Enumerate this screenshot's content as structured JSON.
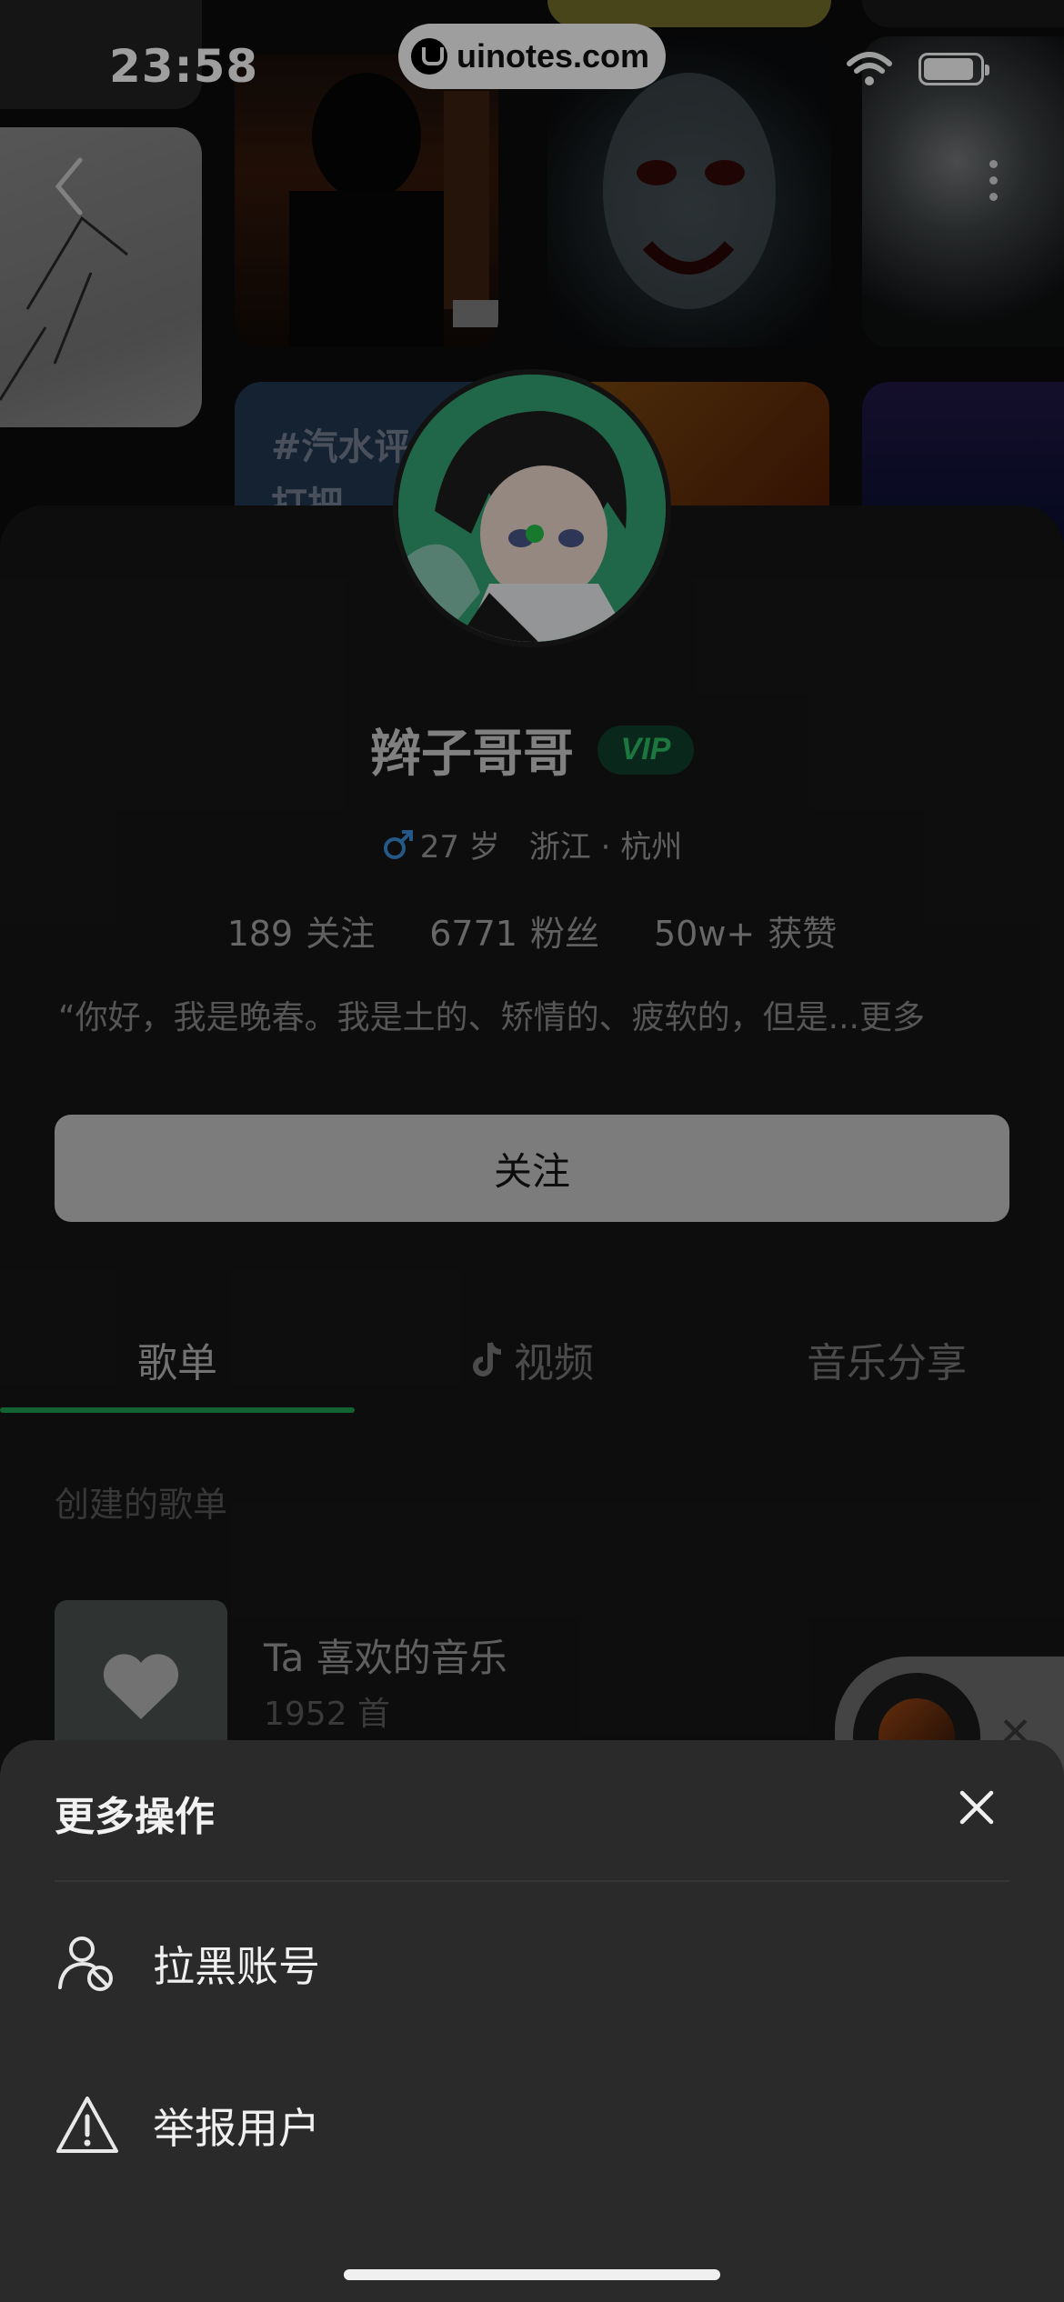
{
  "status_bar": {
    "time": "23:58",
    "url": "uinotes.com"
  },
  "background": {
    "tile_text": "#汽水评\n打把"
  },
  "profile": {
    "name": "辫子哥哥",
    "vip_label": "VIP",
    "age": "27 岁",
    "location": "浙江 · 杭州",
    "stats": [
      {
        "num": "189",
        "label": "关注"
      },
      {
        "num": "6771",
        "label": "粉丝"
      },
      {
        "num": "50w+",
        "label": "获赞"
      }
    ],
    "bio": "“你好，我是晚春。我是土的、矫情的、疲软的，但是...",
    "bio_more": "更多",
    "follow_label": "关注"
  },
  "tabs": [
    {
      "label": "歌单"
    },
    {
      "label": "视频"
    },
    {
      "label": "音乐分享"
    }
  ],
  "section_title": "创建的歌单",
  "playlist": {
    "name": "Ta 喜欢的音乐",
    "count": "1952 首"
  },
  "sheet": {
    "title": "更多操作",
    "items": [
      {
        "label": "拉黑账号",
        "icon": "block-user-icon"
      },
      {
        "label": "举报用户",
        "icon": "warning-icon"
      }
    ]
  },
  "colors": {
    "accent": "#1f9f55",
    "vip": "#2ec065",
    "sheet_bg": "#2a2a2a"
  }
}
